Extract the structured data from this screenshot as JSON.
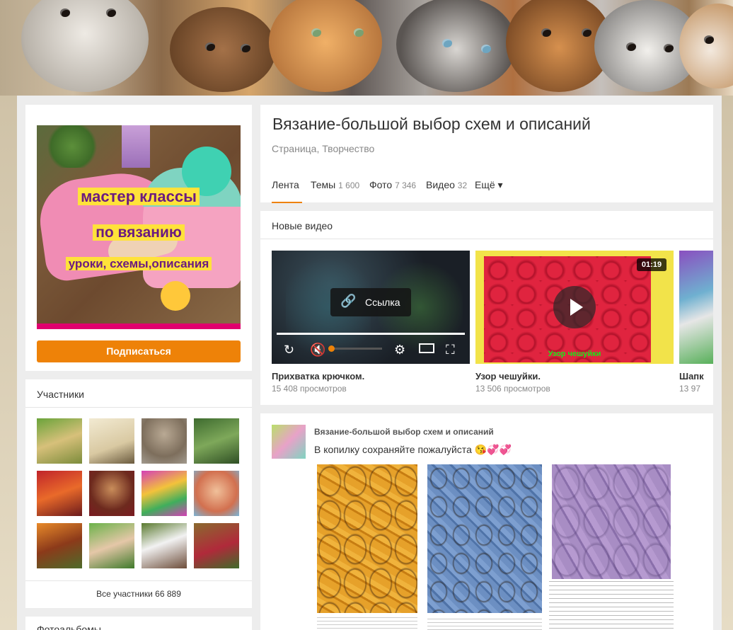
{
  "group": {
    "title": "Вязание-большой выбор схем и описаний",
    "subtitle": "Страница, Творчество"
  },
  "cover": {
    "line1": "мастер классы",
    "line2": "по вязанию",
    "line3": "уроки, схемы,описания"
  },
  "subscribe_label": "Подписаться",
  "tabs": [
    {
      "label": "Лента",
      "count": ""
    },
    {
      "label": "Темы",
      "count": "1 600"
    },
    {
      "label": "Фото",
      "count": "7 346"
    },
    {
      "label": "Видео",
      "count": "32"
    },
    {
      "label": "Ещё ▾",
      "count": ""
    }
  ],
  "members": {
    "title": "Участники",
    "all_label": "Все участники 66 889"
  },
  "photo_albums_title": "Фотоальбомы",
  "videos": {
    "title": "Новые видео",
    "link_tooltip": "Ссылка",
    "items": [
      {
        "title": "Прихватка крючком.",
        "views": "15 408 просмотров",
        "duration": ""
      },
      {
        "title": "Узор чешуйки.",
        "views": "13 506 просмотров",
        "duration": "01:19",
        "overlay": "Узор чешуйки"
      },
      {
        "title": "Шапк",
        "views": "13 97"
      }
    ]
  },
  "post": {
    "author": "Вязание-большой выбор схем и описаний",
    "text": "В копилку сохраняйте пожалуйста"
  },
  "colors": {
    "accent": "#ee8208",
    "tab_active": "#ee8208"
  }
}
